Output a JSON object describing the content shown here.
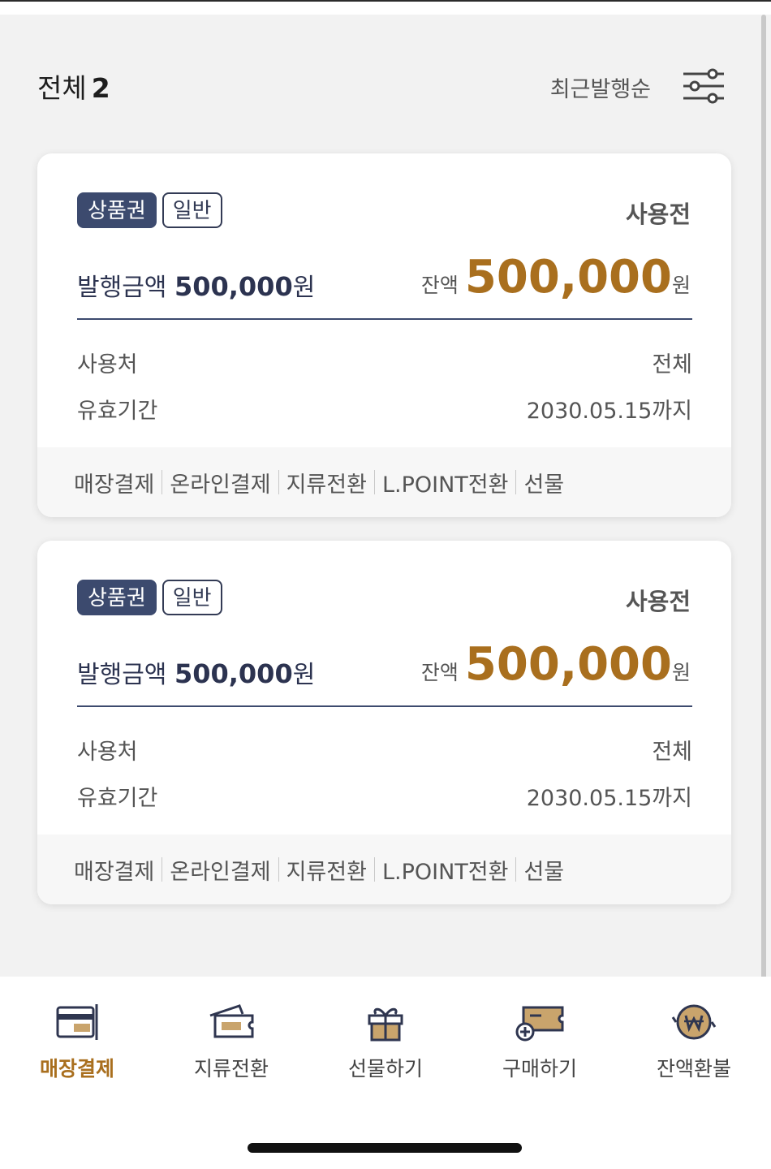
{
  "header": {
    "title": "전체",
    "count": "2",
    "sort_label": "최근발행순"
  },
  "cards": [
    {
      "type_badge": "상품권",
      "kind_badge": "일반",
      "status": "사용전",
      "issue_label": "발행금액",
      "issue_amount": "500,000",
      "issue_unit": "원",
      "balance_label": "잔액",
      "balance_amount": "500,000",
      "balance_unit": "원",
      "usage_label": "사용처",
      "usage_value": "전체",
      "validity_label": "유효기간",
      "validity_value": "2030.05.15까지",
      "actions": [
        "매장결제",
        "온라인결제",
        "지류전환",
        "L.POINT전환",
        "선물"
      ]
    },
    {
      "type_badge": "상품권",
      "kind_badge": "일반",
      "status": "사용전",
      "issue_label": "발행금액",
      "issue_amount": "500,000",
      "issue_unit": "원",
      "balance_label": "잔액",
      "balance_amount": "500,000",
      "balance_unit": "원",
      "usage_label": "사용처",
      "usage_value": "전체",
      "validity_label": "유효기간",
      "validity_value": "2030.05.15까지",
      "actions": [
        "매장결제",
        "온라인결제",
        "지류전환",
        "L.POINT전환",
        "선물"
      ]
    }
  ],
  "bottom_nav": [
    {
      "label": "매장결제",
      "icon": "card-payment-icon",
      "active": true
    },
    {
      "label": "지류전환",
      "icon": "paper-voucher-icon",
      "active": false
    },
    {
      "label": "선물하기",
      "icon": "gift-icon",
      "active": false
    },
    {
      "label": "구매하기",
      "icon": "buy-voucher-icon",
      "active": false
    },
    {
      "label": "잔액환불",
      "icon": "won-refund-icon",
      "active": false
    }
  ],
  "colors": {
    "accent": "#a96f1e",
    "navy": "#3c4a6e",
    "background": "#f2f2f2"
  }
}
